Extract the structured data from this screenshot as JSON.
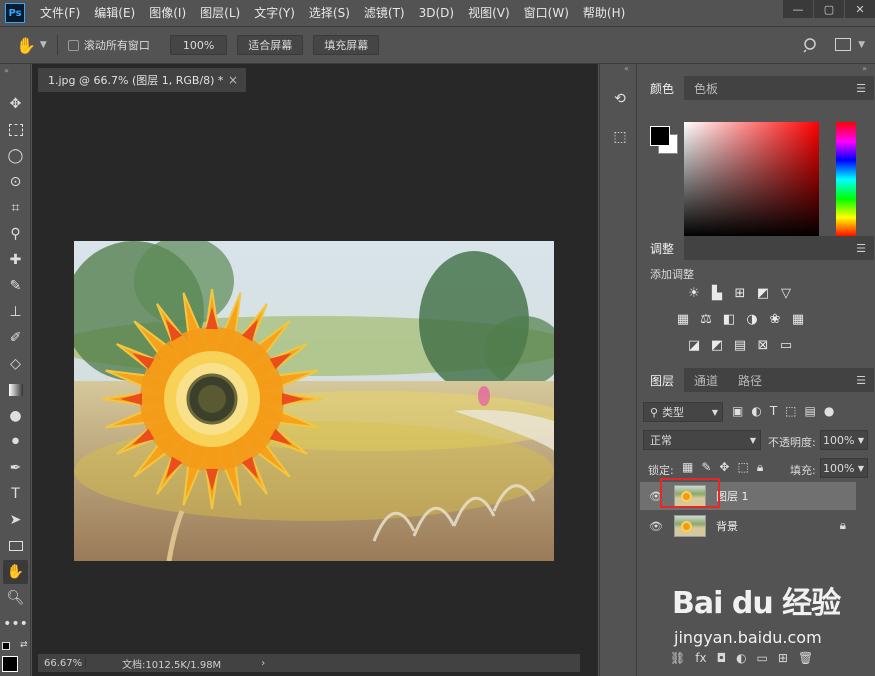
{
  "app": {
    "logo": "Ps"
  },
  "menu": [
    "文件(F)",
    "编辑(E)",
    "图像(I)",
    "图层(L)",
    "文字(Y)",
    "选择(S)",
    "滤镜(T)",
    "3D(D)",
    "视图(V)",
    "窗口(W)",
    "帮助(H)"
  ],
  "window_controls": {
    "minimize": "—",
    "maximize": "▢",
    "close": "✕"
  },
  "options": {
    "tool_icon": "hand-icon",
    "scroll_all_label": "滚动所有窗口",
    "zoom_value": "100%",
    "fit_screen_label": "适合屏幕",
    "fill_screen_label": "填充屏幕"
  },
  "document": {
    "tab_title": "1.jpg @ 66.7% (图层 1, RGB/8) *",
    "close": "×",
    "status_zoom": "66.67%",
    "status_doc": "文档:1012.5K/1.98M",
    "status_arrow": "›"
  },
  "panels": {
    "color": {
      "tabs": [
        "颜色",
        "色板"
      ]
    },
    "adjust": {
      "tab": "调整",
      "add_label": "添加调整"
    },
    "layers": {
      "tabs": [
        "图层",
        "通道",
        "路径"
      ],
      "filter_kind": "类型",
      "blend_mode": "正常",
      "opacity_label": "不透明度:",
      "opacity_value": "100%",
      "lock_label": "锁定:",
      "fill_label": "填充:",
      "fill_value": "100%",
      "layers": [
        {
          "name": "图层 1",
          "selected": true
        },
        {
          "name": "背景",
          "selected": false,
          "locked": true
        }
      ]
    }
  },
  "watermark": {
    "main": "Bai du 经验",
    "sub": "jingyan.baidu.com"
  },
  "colors": {
    "accent": "#31a8ff",
    "highlight": "#e52727"
  }
}
